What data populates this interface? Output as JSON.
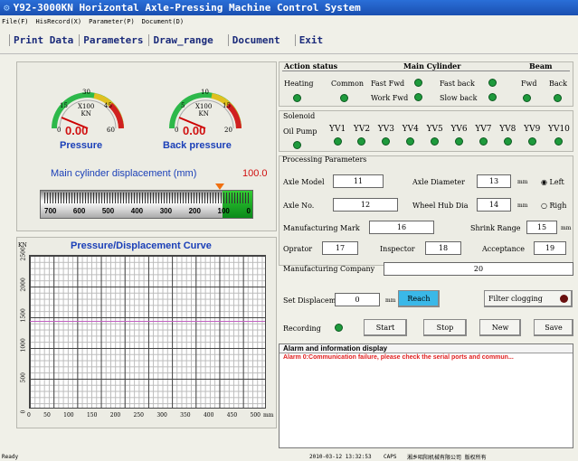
{
  "window": {
    "title": "Y92-3000KN Horizontal Axle-Pressing Machine Control System"
  },
  "menu": [
    "File(F)",
    "HisRecord(X)",
    "Parameter(P)",
    "Document(D)"
  ],
  "toolbar": [
    "Print Data",
    "Parameters",
    "Draw_range",
    "Document",
    "Exit"
  ],
  "gauges": {
    "pressure": {
      "label": "Pressure",
      "unit": "X100\nKN",
      "value": "0.00",
      "ticks": [
        "15",
        "30",
        "45",
        "60",
        "0"
      ]
    },
    "back": {
      "label": "Back pressure",
      "unit": "X100\nKN",
      "value": "0.00",
      "ticks": [
        "5",
        "10",
        "15",
        "20",
        "0"
      ]
    }
  },
  "displacement": {
    "label": "Main cylinder displacement (mm)",
    "value": "100.0",
    "scale": [
      "700",
      "600",
      "500",
      "400",
      "300",
      "200",
      "100",
      "0"
    ],
    "fill": 0.14
  },
  "curve": {
    "title": "Pressure/Displacement Curve",
    "y_unit": "KN",
    "y_ticks": [
      "2500",
      "2000",
      "1500",
      "1000",
      "500",
      "0"
    ],
    "x_ticks": [
      "0",
      "50",
      "100",
      "150",
      "200",
      "250",
      "300",
      "350",
      "400",
      "450",
      "500"
    ],
    "x_unit": "mm"
  },
  "action": {
    "title": "Action status",
    "main_cyl": "Main Cylinder",
    "beam": "Beam",
    "heating": "Heating",
    "common": "Common",
    "fast_fwd": "Fast Fwd",
    "fast_back": "Fast back",
    "work_fwd": "Work Fwd",
    "slow_back": "Slow back",
    "fwd": "Fwd",
    "back": "Back"
  },
  "solenoid": {
    "title": "Solenoid",
    "oil_pump": "Oil Pump",
    "valves": [
      "YV1",
      "YV2",
      "YV3",
      "YV4",
      "YV5",
      "YV6",
      "YV7",
      "YV8",
      "YV9",
      "YV10"
    ]
  },
  "processing": {
    "title": "Processing Parameters",
    "axle_model": "Axle Model",
    "axle_model_val": "11",
    "axle_diameter": "Axle Diameter",
    "axle_diameter_val": "13",
    "mm": "mm",
    "left": "Left",
    "right": "Righ",
    "axle_no": "Axle No.",
    "axle_no_val": "12",
    "wheel_hub": "Wheel Hub Dia",
    "wheel_hub_val": "14",
    "mfg_mark": "Manufacturing Mark",
    "mfg_mark_val": "16",
    "shrink": "Shrink Range",
    "shrink_val": "15",
    "operator": "Oprator",
    "operator_val": "17",
    "inspector": "Inspector",
    "inspector_val": "18",
    "acceptance": "Acceptance",
    "acceptance_val": "19",
    "company": "Manufacturing Company",
    "company_val": "20"
  },
  "controls": {
    "set_disp": "Set Displacement",
    "set_disp_val": "0",
    "mm": "mm",
    "reach": "Reach",
    "filter": "Filter clogging",
    "recording": "Recording",
    "start": "Start",
    "stop": "Stop",
    "new": "New",
    "save": "Save"
  },
  "alarm": {
    "title": "Alarm and information display",
    "message": "Alarm 0:Communication failure, please check the serial ports and commun..."
  },
  "status": {
    "left": "Ready",
    "datetime": "2010-03-12 13:32:53",
    "cap": "CAPS",
    "company": "湘乡昭阳机械有限公司 版权所有"
  }
}
